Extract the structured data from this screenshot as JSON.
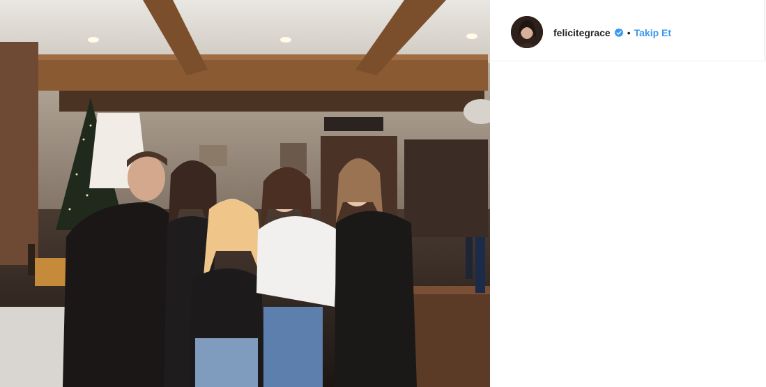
{
  "post": {
    "username": "felicitegrace",
    "separator": "•",
    "follow_label": "Takip Et"
  },
  "colors": {
    "accent": "#3897f0",
    "verified": "#3897f0",
    "text": "#262626"
  },
  "icons": {
    "verified": "verified-badge-icon"
  }
}
